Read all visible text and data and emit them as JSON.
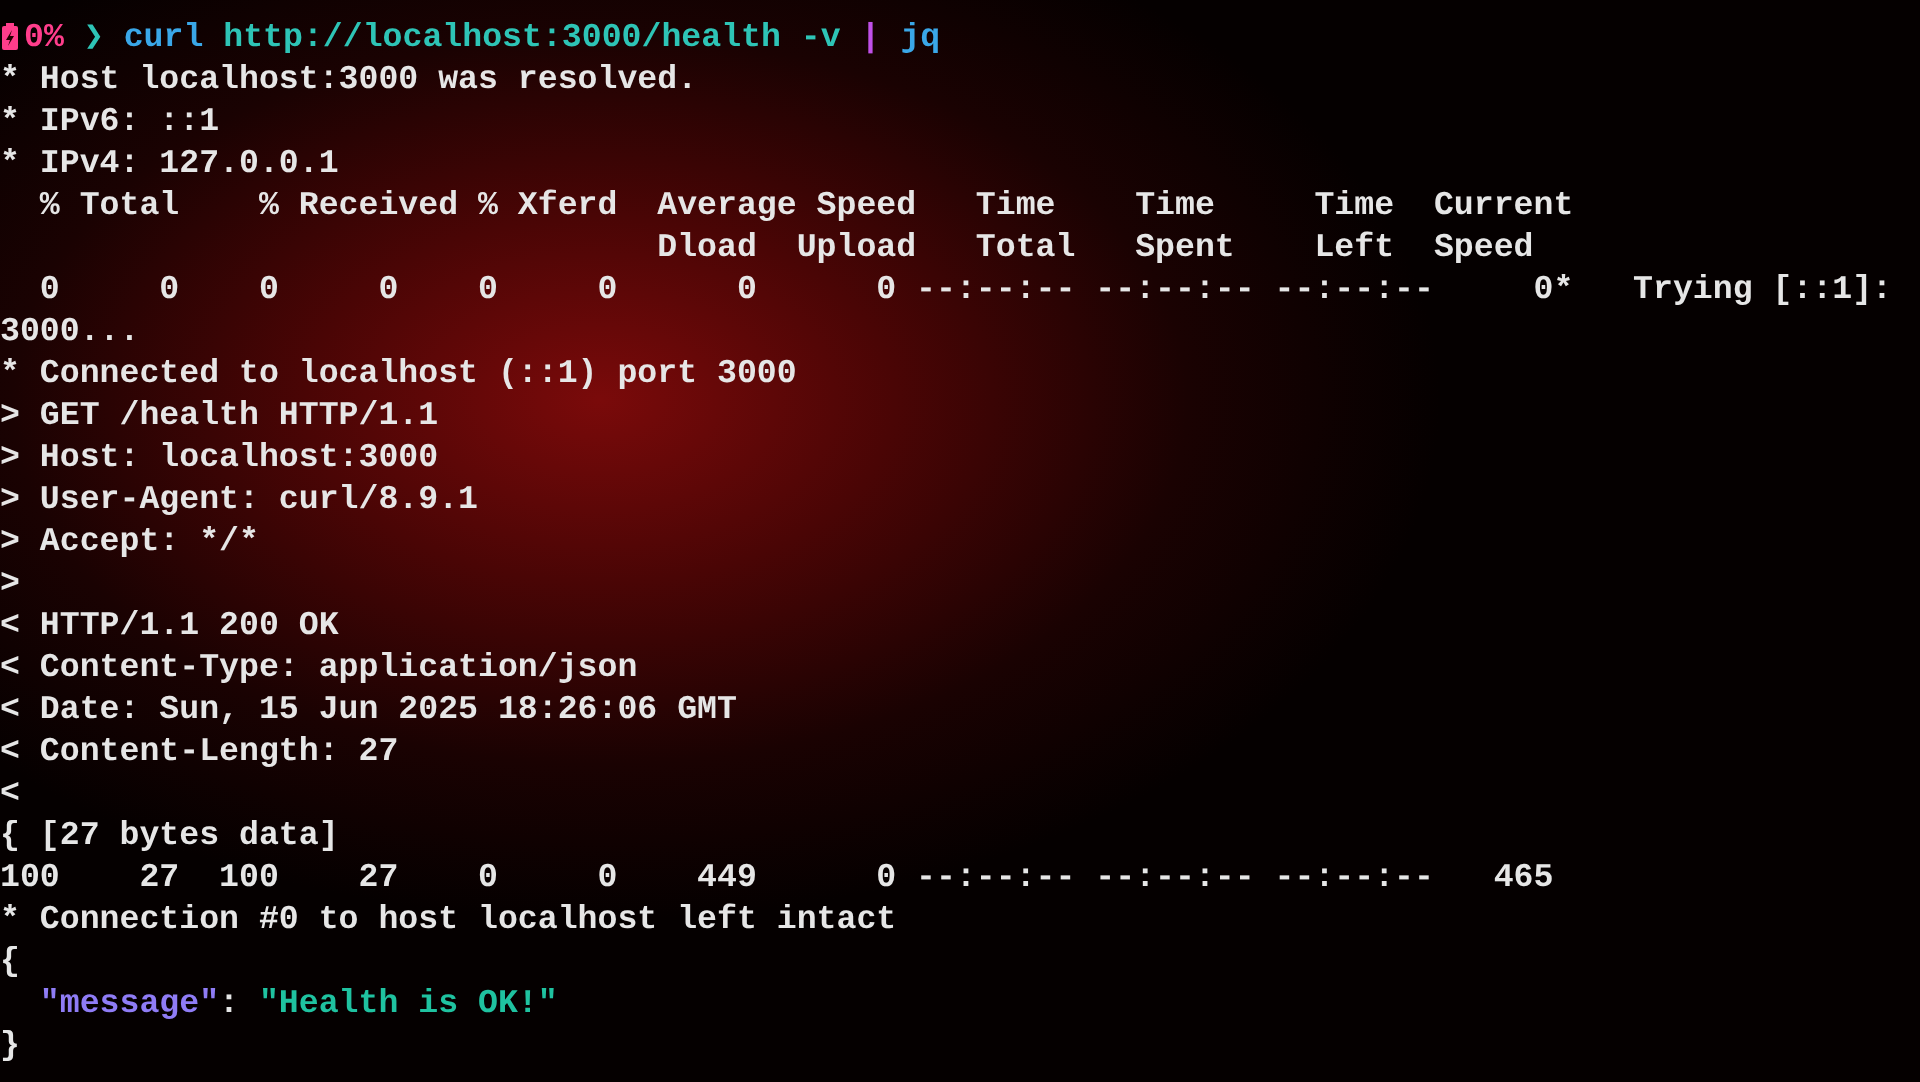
{
  "prompt": {
    "segments": [
      {
        "kind": "percent",
        "text": "0%"
      },
      {
        "kind": "chevron",
        "text": " ❯ "
      },
      {
        "kind": "command",
        "text": "curl"
      },
      {
        "kind": "arg",
        "text": " http://localhost:3000/health -v "
      },
      {
        "kind": "pipe",
        "text": "|"
      },
      {
        "kind": "command",
        "text": " jq"
      }
    ]
  },
  "lines": [
    [
      {
        "kind": "plain",
        "text": "* Host localhost:3000 was resolved."
      }
    ],
    [
      {
        "kind": "plain",
        "text": "* IPv6: ::1"
      }
    ],
    [
      {
        "kind": "plain",
        "text": "* IPv4: 127.0.0.1"
      }
    ],
    [
      {
        "kind": "plain",
        "text": "  % Total    % Received % Xferd  Average Speed   Time    Time     Time  Current"
      }
    ],
    [
      {
        "kind": "plain",
        "text": "                                 Dload  Upload   Total   Spent    Left  Speed"
      }
    ],
    [
      {
        "kind": "plain",
        "text": "  0     0    0     0    0     0      0      0 --:--:-- --:--:-- --:--:--     0*   Trying [::1]:"
      }
    ],
    [
      {
        "kind": "plain",
        "text": "3000..."
      }
    ],
    [
      {
        "kind": "plain",
        "text": "* Connected to localhost (::1) port 3000"
      }
    ],
    [
      {
        "kind": "plain",
        "text": "> GET /health HTTP/1.1"
      }
    ],
    [
      {
        "kind": "plain",
        "text": "> Host: localhost:3000"
      }
    ],
    [
      {
        "kind": "plain",
        "text": "> User-Agent: curl/8.9.1"
      }
    ],
    [
      {
        "kind": "plain",
        "text": "> Accept: */*"
      }
    ],
    [
      {
        "kind": "plain",
        "text": ">"
      }
    ],
    [
      {
        "kind": "plain",
        "text": "< HTTP/1.1 200 OK"
      }
    ],
    [
      {
        "kind": "plain",
        "text": "< Content-Type: application/json"
      }
    ],
    [
      {
        "kind": "plain",
        "text": "< Date: Sun, 15 Jun 2025 18:26:06 GMT"
      }
    ],
    [
      {
        "kind": "plain",
        "text": "< Content-Length: 27"
      }
    ],
    [
      {
        "kind": "plain",
        "text": "<"
      }
    ],
    [
      {
        "kind": "plain",
        "text": "{ [27 bytes data]"
      }
    ],
    [
      {
        "kind": "plain",
        "text": "100    27  100    27    0     0    449      0 --:--:-- --:--:-- --:--:--   465"
      }
    ],
    [
      {
        "kind": "plain",
        "text": "* Connection #0 to host localhost left intact"
      }
    ],
    [
      {
        "kind": "plain",
        "text": "{"
      }
    ],
    [
      {
        "kind": "key",
        "text": "  \"message\""
      },
      {
        "kind": "plain",
        "text": ": "
      },
      {
        "kind": "string",
        "text": "\"Health is OK!\""
      }
    ],
    [
      {
        "kind": "plain",
        "text": "}"
      }
    ]
  ]
}
